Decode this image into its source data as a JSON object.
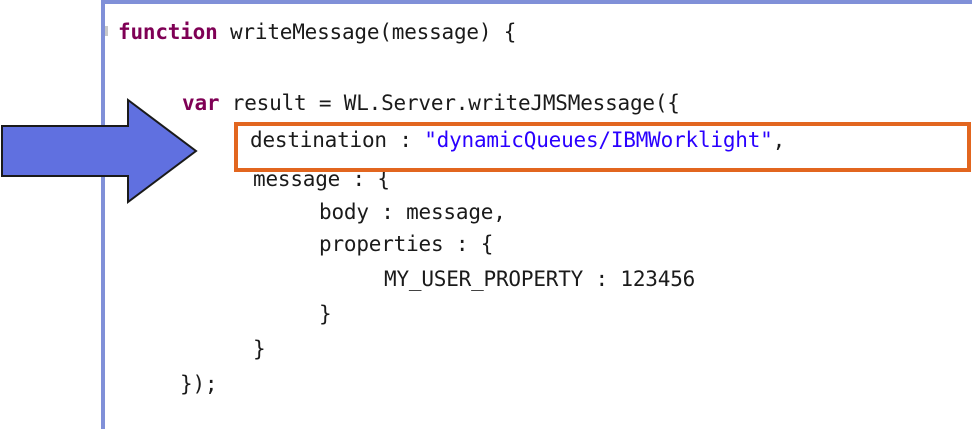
{
  "code": {
    "line1": {
      "kw": "function",
      "rest": " writeMessage(message) {"
    },
    "line2": {
      "kw": "var",
      "rest": " result = WL.Server.writeJMSMessage({"
    },
    "line3": {
      "prop": "destination : ",
      "str": "\"dynamicQueues/IBMWorklight\"",
      "tail": ","
    },
    "line4": {
      "text": "message : {"
    },
    "line5": {
      "text": "body : message,"
    },
    "line6": {
      "text": "properties : {"
    },
    "line7": {
      "text": "MY_USER_PROPERTY : 123456"
    },
    "line8": {
      "text": "}"
    },
    "line9": {
      "text": "}"
    },
    "line10": {
      "text": "});"
    }
  },
  "colors": {
    "keyword": "#7f0055",
    "string": "#2a00ff",
    "highlight": "#e2661f",
    "arrow_fill": "#6070e0",
    "editor_border": "#8090d8"
  },
  "icons": {
    "pointer": "right-arrow-icon"
  }
}
